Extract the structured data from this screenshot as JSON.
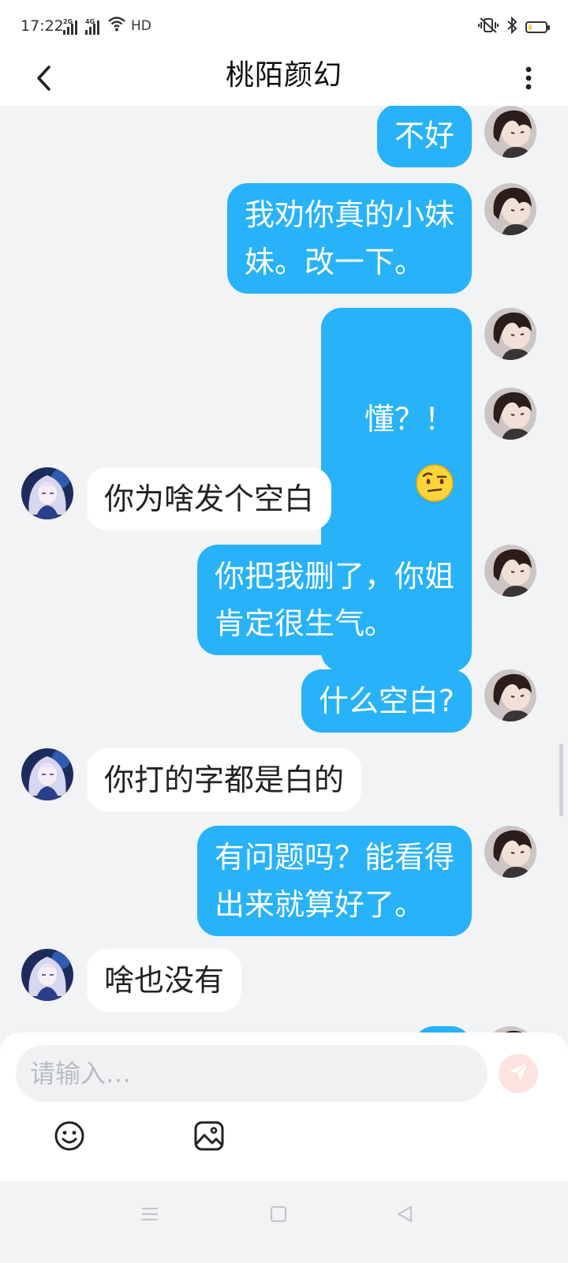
{
  "status_bar": {
    "time": "17:22",
    "signal1_tag": "2G",
    "signal2_tag": "4G",
    "network_label": "HD",
    "battery_color": "#f2d54a"
  },
  "header": {
    "title": "桃陌颜幻",
    "back_icon": "chevron-left-icon",
    "more_icon": "vertical-dots-icon"
  },
  "messages": [
    {
      "sender": "me",
      "text": "不好"
    },
    {
      "sender": "me",
      "text": "我劝你真的小妹\n妹。改一下。"
    },
    {
      "sender": "me",
      "type": "emoji",
      "emoji": "raised-eyebrow-face-emoji"
    },
    {
      "sender": "me",
      "text": "懂？！"
    },
    {
      "sender": "them",
      "text": "你为啥发个空白"
    },
    {
      "sender": "me",
      "text": "你把我删了，你姐\n肯定很生气。"
    },
    {
      "sender": "me",
      "text": "什么空白?"
    },
    {
      "sender": "them",
      "text": "你打的字都是白的"
    },
    {
      "sender": "me",
      "text": "有问题吗？能看得\n出来就算好了。"
    },
    {
      "sender": "them",
      "text": "啥也没有"
    }
  ],
  "input": {
    "placeholder": "请输入…",
    "value": ""
  },
  "toolbar": {
    "emoji_icon": "smiley-icon",
    "image_icon": "image-icon",
    "send_icon": "paper-plane-icon"
  },
  "colors": {
    "my_bubble": "#27b2f9",
    "their_bubble": "#ffffff",
    "background": "#f2f3f5",
    "send_button": "#fde3df"
  },
  "nav_bar": {
    "menu_icon": "menu-icon",
    "home_icon": "square-icon",
    "back_icon": "triangle-back-icon"
  }
}
